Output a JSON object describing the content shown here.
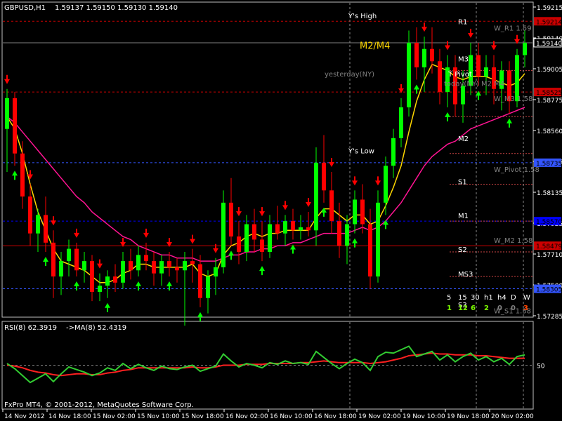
{
  "header": {
    "symbol": "GBPUSD,H1",
    "ohlc": "1.59137 1.59150 1.59130 1.59140"
  },
  "rsi_header": {
    "title": "RSI(8) 62.3919",
    "ma": "->MA(8) 52.4319"
  },
  "footer": {
    "copyright": "FxPro MT4, © 2001-2012, MetaQuotes Software Corp."
  },
  "colors": {
    "bull": "#00ff00",
    "bear": "#ff0000",
    "ma_fast": "#ffd700",
    "ma_slow": "#ff1493",
    "grid": "#808080",
    "axis_bg": "#000000",
    "blue_line": "#0000ff",
    "red_level": "#cc0000",
    "pivot_label": "#ffffff",
    "weekly_label": "#808080",
    "rsi_line": "#32cd32",
    "rsi_ma": "#ff2020"
  },
  "chart_data": {
    "type": "candlestick",
    "title": "GBPUSD,H1",
    "ylim": [
      1.5825,
      1.5927
    ],
    "price_ticks": [
      "1.59215",
      "1.59000",
      "1.58790",
      "1.58560",
      "1.58345",
      "1.58135",
      "1.57925",
      "1.57710",
      "1.57500",
      "1.57285"
    ],
    "price_tick_values": [
      1.5921,
      1.5905,
      1.5888,
      1.5871,
      1.5855,
      1.5838,
      1.5822,
      1.5805,
      1.5789,
      1.5773
    ],
    "price_labels_display": [
      "1.59215",
      "1.59140",
      "1.59005",
      "1.58775",
      "1.58560",
      "1.58345",
      "1.58135",
      "1.57925",
      "1.57710",
      "1.57500"
    ],
    "highlight_prices": [
      {
        "text": "1.59214",
        "color": "#cc0000",
        "value": 1.5921
      },
      {
        "text": "1.59140",
        "color": "#ffffff",
        "value": 1.5914
      },
      {
        "text": "1.58525",
        "color": "#cc0000",
        "value": 1.5898
      },
      {
        "text": "1.58735",
        "color": "#3355ff",
        "value": 1.5875
      },
      {
        "text": "1.58479",
        "color": "#cc0000",
        "value": 1.5848
      },
      {
        "text": "1.58305",
        "color": "#3355ff",
        "value": 1.5834
      },
      {
        "text": "1.58570",
        "color": "#0000ff",
        "value": 1.5856
      }
    ],
    "axis_ticks": [
      "1.59215",
      "1.59140",
      "1.59005",
      "1.58775",
      "1.58560",
      "1.58345",
      "1.58135",
      "1.57925",
      "1.57710",
      "1.57500",
      "1.57285"
    ],
    "time_labels": [
      "14 Nov 2012",
      "14 Nov 18:00",
      "15 Nov 02:00",
      "15 Nov 10:00",
      "15 Nov 18:00",
      "16 Nov 02:00",
      "16 Nov 10:00",
      "16 Nov 18:00",
      "19 Nov 02:00",
      "19 Nov 10:00",
      "19 Nov 18:00",
      "20 Nov 02:00"
    ],
    "pivot_labels": [
      "R1",
      "M3",
      "M2",
      "S1",
      "M1",
      "S2",
      "MS3",
      "S3"
    ],
    "weekly_labels": [
      "W_R1 1.59",
      "W_M3 1.58",
      "W_Pivot 1.58",
      "W_M2 1.58",
      "W_S1 1.58"
    ],
    "day_labels": [
      "Y's High",
      "Y's Low",
      "yesterday(NY)",
      "today(NY) M2 M4",
      "T Pivot"
    ],
    "m2m4_label": "M2/M4",
    "timeframes": {
      "labels": [
        "5",
        "15",
        "30",
        "h1",
        "h4",
        "D",
        "W"
      ],
      "values": [
        "1",
        "12",
        "6",
        "2",
        "0",
        "0",
        "3"
      ],
      "value_colors": [
        "#7cfc00",
        "#7cfc00",
        "#7cfc00",
        "#7cfc00",
        "#808080",
        "#808080",
        "#ff4500"
      ]
    },
    "rsi": {
      "ylim": [
        0,
        100
      ],
      "level": 50,
      "level_label": "50"
    },
    "candles": [
      [
        1.5886,
        1.5899,
        1.5872,
        1.5896
      ],
      [
        1.5896,
        1.5898,
        1.5874,
        1.5878
      ],
      [
        1.5878,
        1.5882,
        1.586,
        1.5864
      ],
      [
        1.5864,
        1.5868,
        1.5848,
        1.5852
      ],
      [
        1.5852,
        1.586,
        1.5846,
        1.5858
      ],
      [
        1.5858,
        1.5864,
        1.5846,
        1.5849
      ],
      [
        1.5849,
        1.5853,
        1.5831,
        1.5838
      ],
      [
        1.5838,
        1.5846,
        1.5832,
        1.5843
      ],
      [
        1.5843,
        1.585,
        1.5838,
        1.5847
      ],
      [
        1.5847,
        1.5849,
        1.5838,
        1.584
      ],
      [
        1.584,
        1.5846,
        1.5836,
        1.5843
      ],
      [
        1.5843,
        1.5845,
        1.583,
        1.5833
      ],
      [
        1.5833,
        1.5839,
        1.583,
        1.5835
      ],
      [
        1.5835,
        1.584,
        1.5831,
        1.5838
      ],
      [
        1.5838,
        1.5842,
        1.5833,
        1.5836
      ],
      [
        1.5836,
        1.5846,
        1.5834,
        1.5843
      ],
      [
        1.5843,
        1.5847,
        1.5837,
        1.584
      ],
      [
        1.584,
        1.5848,
        1.5838,
        1.5845
      ],
      [
        1.5845,
        1.5849,
        1.584,
        1.5843
      ],
      [
        1.5843,
        1.5846,
        1.5835,
        1.5839
      ],
      [
        1.5839,
        1.5845,
        1.5835,
        1.5843
      ],
      [
        1.5843,
        1.5846,
        1.5838,
        1.5841
      ],
      [
        1.5841,
        1.5844,
        1.5836,
        1.584
      ],
      [
        1.584,
        1.5846,
        1.5822,
        1.5843
      ],
      [
        1.5843,
        1.5847,
        1.5836,
        1.5842
      ],
      [
        1.5842,
        1.5845,
        1.5828,
        1.5831
      ],
      [
        1.5831,
        1.584,
        1.5826,
        1.5838
      ],
      [
        1.5838,
        1.5844,
        1.5832,
        1.5841
      ],
      [
        1.5841,
        1.5866,
        1.5839,
        1.5862
      ],
      [
        1.5862,
        1.587,
        1.5848,
        1.5851
      ],
      [
        1.5851,
        1.5856,
        1.5842,
        1.5846
      ],
      [
        1.5846,
        1.5858,
        1.5843,
        1.5855
      ],
      [
        1.5855,
        1.586,
        1.5846,
        1.585
      ],
      [
        1.585,
        1.5856,
        1.5843,
        1.5846
      ],
      [
        1.5846,
        1.5858,
        1.5844,
        1.5855
      ],
      [
        1.5855,
        1.5861,
        1.585,
        1.5852
      ],
      [
        1.5852,
        1.5858,
        1.5848,
        1.5856
      ],
      [
        1.5856,
        1.586,
        1.585,
        1.5853
      ],
      [
        1.5853,
        1.5858,
        1.585,
        1.5854
      ],
      [
        1.5854,
        1.5859,
        1.5851,
        1.5853
      ],
      [
        1.5853,
        1.588,
        1.5848,
        1.5875
      ],
      [
        1.5875,
        1.5884,
        1.5862,
        1.5866
      ],
      [
        1.5866,
        1.5872,
        1.5852,
        1.5856
      ],
      [
        1.5856,
        1.5862,
        1.5844,
        1.5848
      ],
      [
        1.5848,
        1.5858,
        1.5842,
        1.5855
      ],
      [
        1.5855,
        1.5866,
        1.5852,
        1.5863
      ],
      [
        1.5863,
        1.5868,
        1.5852,
        1.5855
      ],
      [
        1.5855,
        1.586,
        1.5834,
        1.5838
      ],
      [
        1.5838,
        1.5866,
        1.5836,
        1.5862
      ],
      [
        1.5862,
        1.5877,
        1.5858,
        1.5874
      ],
      [
        1.5874,
        1.5886,
        1.587,
        1.5883
      ],
      [
        1.5883,
        1.5896,
        1.588,
        1.5893
      ],
      [
        1.5893,
        1.5918,
        1.589,
        1.5914
      ],
      [
        1.5914,
        1.5919,
        1.5902,
        1.5906
      ],
      [
        1.5906,
        1.5916,
        1.5898,
        1.5912
      ],
      [
        1.5912,
        1.5919,
        1.5904,
        1.5908
      ],
      [
        1.5908,
        1.5912,
        1.5894,
        1.5898
      ],
      [
        1.5898,
        1.591,
        1.5893,
        1.5906
      ],
      [
        1.5906,
        1.591,
        1.589,
        1.5894
      ],
      [
        1.5894,
        1.5905,
        1.5888,
        1.59
      ],
      [
        1.59,
        1.5914,
        1.5897,
        1.591
      ],
      [
        1.591,
        1.5914,
        1.59,
        1.5903
      ],
      [
        1.5903,
        1.591,
        1.5897,
        1.5906
      ],
      [
        1.5906,
        1.591,
        1.5894,
        1.5899
      ],
      [
        1.5899,
        1.5908,
        1.5892,
        1.5905
      ],
      [
        1.5905,
        1.5908,
        1.5891,
        1.5895
      ],
      [
        1.5895,
        1.5912,
        1.5893,
        1.591
      ],
      [
        1.591,
        1.5918,
        1.5906,
        1.5914
      ]
    ],
    "ma_fast": [
      1.589,
      1.5886,
      1.5878,
      1.5868,
      1.5859,
      1.5853,
      1.5847,
      1.5843,
      1.5842,
      1.5841,
      1.584,
      1.5838,
      1.5836,
      1.5836,
      1.5837,
      1.5839,
      1.584,
      1.5842,
      1.5842,
      1.5841,
      1.5841,
      1.5841,
      1.5841,
      1.5841,
      1.5842,
      1.5839,
      1.5838,
      1.5839,
      1.5845,
      1.5848,
      1.5849,
      1.5851,
      1.5852,
      1.5851,
      1.5852,
      1.5852,
      1.5853,
      1.5853,
      1.5853,
      1.5853,
      1.5857,
      1.586,
      1.586,
      1.5858,
      1.5856,
      1.5858,
      1.5858,
      1.5855,
      1.5856,
      1.5861,
      1.5867,
      1.5874,
      1.5885,
      1.5895,
      1.5902,
      1.5907,
      1.5906,
      1.5905,
      1.5903,
      1.5902,
      1.5903,
      1.5903,
      1.5903,
      1.5902,
      1.5901,
      1.59,
      1.5901,
      1.5904
    ],
    "ma_slow": [
      1.589,
      1.5888,
      1.5885,
      1.5882,
      1.5879,
      1.5876,
      1.5873,
      1.587,
      1.5867,
      1.5864,
      1.5862,
      1.5859,
      1.5857,
      1.5855,
      1.5853,
      1.5851,
      1.585,
      1.5848,
      1.5847,
      1.5846,
      1.5845,
      1.5845,
      1.5844,
      1.5844,
      1.5844,
      1.5843,
      1.5843,
      1.5843,
      1.5844,
      1.5845,
      1.5845,
      1.5846,
      1.5846,
      1.5847,
      1.5847,
      1.5848,
      1.5848,
      1.5849,
      1.5849,
      1.585,
      1.5851,
      1.5852,
      1.5852,
      1.5852,
      1.5852,
      1.5853,
      1.5854,
      1.5853,
      1.5854,
      1.5856,
      1.5859,
      1.5862,
      1.5866,
      1.587,
      1.5874,
      1.5877,
      1.5879,
      1.5881,
      1.5882,
      1.5884,
      1.5886,
      1.5887,
      1.5888,
      1.5889,
      1.589,
      1.5891,
      1.5892,
      1.5893
    ],
    "rsi_values": [
      52,
      46,
      38,
      30,
      35,
      40,
      31,
      40,
      48,
      45,
      42,
      38,
      41,
      47,
      44,
      52,
      46,
      51,
      47,
      44,
      49,
      46,
      45,
      48,
      50,
      43,
      46,
      49,
      63,
      55,
      48,
      52,
      50,
      47,
      53,
      51,
      55,
      52,
      53,
      51,
      66,
      59,
      52,
      46,
      52,
      57,
      53,
      44,
      60,
      65,
      64,
      68,
      72,
      60,
      63,
      66,
      56,
      62,
      54,
      60,
      64,
      56,
      60,
      54,
      58,
      51,
      60,
      62
    ],
    "rsi_ma": [
      50,
      49,
      47,
      44,
      42,
      41,
      39,
      38,
      39,
      40,
      40,
      39,
      39,
      41,
      42,
      44,
      45,
      47,
      47,
      47,
      47,
      47,
      47,
      47,
      48,
      47,
      47,
      48,
      50,
      50,
      50,
      51,
      51,
      51,
      52,
      52,
      52,
      52,
      53,
      53,
      54,
      55,
      54,
      53,
      53,
      53,
      53,
      52,
      53,
      54,
      56,
      58,
      61,
      62,
      63,
      64,
      63,
      63,
      62,
      62,
      62,
      61,
      61,
      60,
      59,
      58,
      58,
      58
    ]
  }
}
